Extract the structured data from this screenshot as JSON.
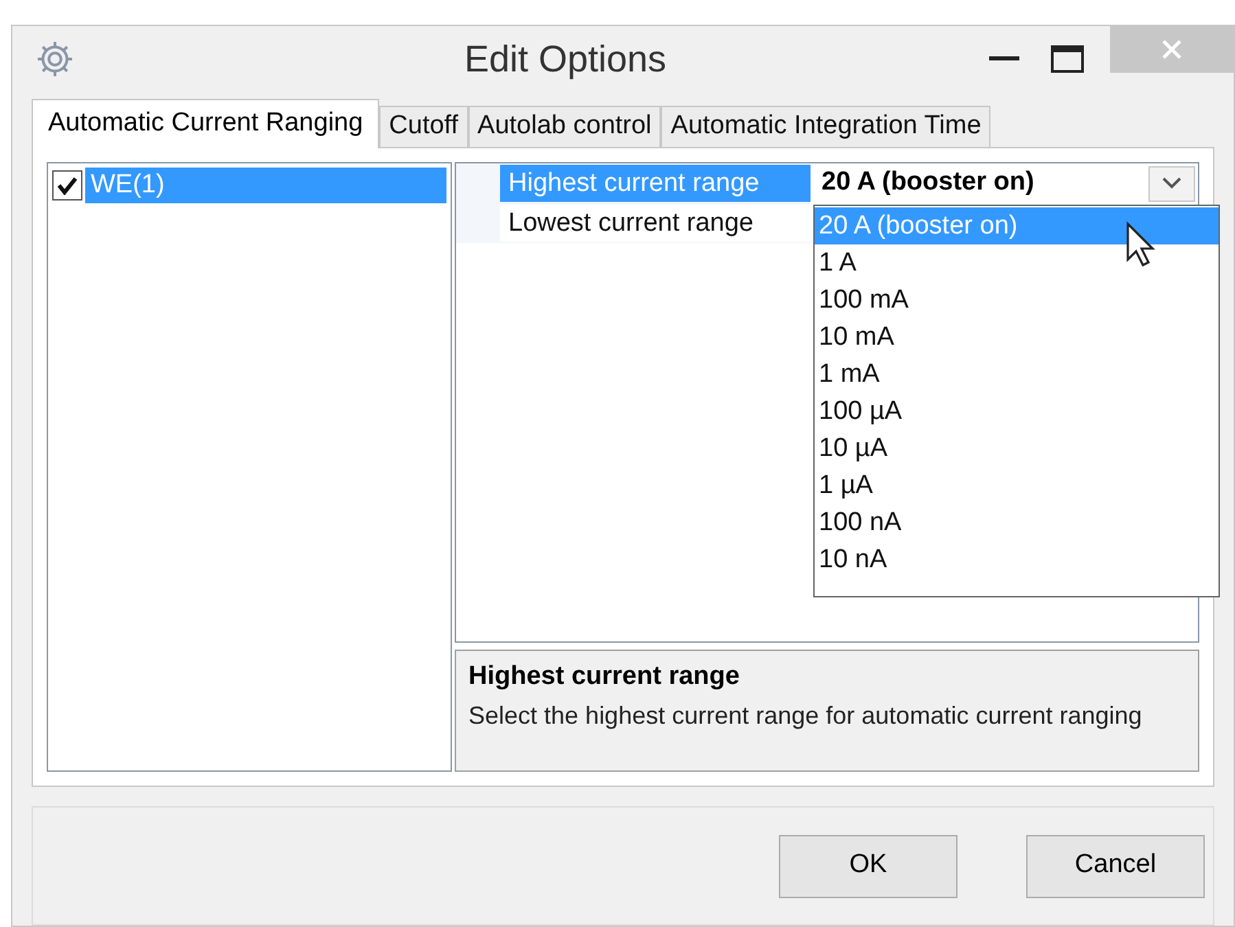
{
  "window": {
    "title": "Edit Options"
  },
  "tabs": [
    {
      "label": "Automatic Current Ranging",
      "selected": true
    },
    {
      "label": "Cutoff",
      "selected": false
    },
    {
      "label": "Autolab control",
      "selected": false
    },
    {
      "label": "Automatic Integration Time",
      "selected": false
    }
  ],
  "tree": [
    {
      "label": "WE(1)",
      "checked": true,
      "selected": true
    }
  ],
  "properties": [
    {
      "name": "Highest current range",
      "value": "20 A (booster on)",
      "selected": true
    },
    {
      "name": "Lowest current range",
      "selected": false
    }
  ],
  "dropdown": {
    "options": [
      {
        "label": "20 A (booster on)",
        "selected": true
      },
      {
        "label": "1 A",
        "selected": false
      },
      {
        "label": "100 mA",
        "selected": false
      },
      {
        "label": "10 mA",
        "selected": false
      },
      {
        "label": "1 mA",
        "selected": false
      },
      {
        "label": "100 µA",
        "selected": false
      },
      {
        "label": "10 µA",
        "selected": false
      },
      {
        "label": "1 µA",
        "selected": false
      },
      {
        "label": "100 nA",
        "selected": false
      },
      {
        "label": "10 nA",
        "selected": false
      }
    ]
  },
  "description": {
    "title": "Highest current range",
    "text": "Select the highest current range for automatic current ranging"
  },
  "buttons": [
    "OK",
    "Cancel"
  ]
}
